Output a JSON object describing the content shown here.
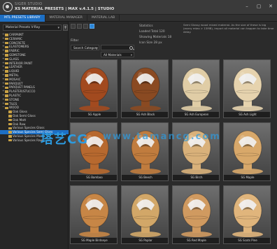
{
  "window": {
    "brand": "SIGER STUDIO",
    "title": "XS MATERIAL PRESETS | MAX v.4.1.5 | STUDIO",
    "icons": [
      "minimize-icon",
      "maximize-icon",
      "close-icon"
    ],
    "minimize_glyph": "–",
    "maximize_glyph": "▢",
    "close_glyph": "✕"
  },
  "tabs": [
    {
      "label": "MTL PRESETS LIBRARY",
      "active": true
    },
    {
      "label": "MATERIAL MANAGER",
      "active": false
    },
    {
      "label": "MATERIAL LAB",
      "active": false
    }
  ],
  "sidebar": {
    "library_select": "Material Presets V-Ray",
    "add_label": "+",
    "items": [
      {
        "label": "CARPAINT",
        "level": 0
      },
      {
        "label": "CERAMIC",
        "level": 0
      },
      {
        "label": "CONCRETE",
        "level": 0
      },
      {
        "label": "ELASTOMERS",
        "level": 0
      },
      {
        "label": "FABRIC",
        "level": 0
      },
      {
        "label": "GEMSTONE",
        "level": 0
      },
      {
        "label": "GLASS",
        "level": 0
      },
      {
        "label": "INTERIOR PAINT",
        "level": 0
      },
      {
        "label": "LEATHER",
        "level": 0
      },
      {
        "label": "LIQUID",
        "level": 0
      },
      {
        "label": "METAL",
        "level": 0
      },
      {
        "label": "MOSAIC",
        "level": 0
      },
      {
        "label": "PARQUET",
        "level": 0
      },
      {
        "label": "PARQUET PANELS",
        "level": 0
      },
      {
        "label": "PLASTER/STUCCO",
        "level": 0
      },
      {
        "label": "PLASTIC",
        "level": 0
      },
      {
        "label": "STONE",
        "level": 0
      },
      {
        "label": "TILES",
        "level": 0
      },
      {
        "label": "WOOD",
        "level": 0
      },
      {
        "label": "Oak Gloss",
        "level": 1
      },
      {
        "label": "Oak Semi Gloss",
        "level": 1
      },
      {
        "label": "Oak Matt",
        "level": 1
      },
      {
        "label": "Oak Raw",
        "level": 1
      },
      {
        "label": "Various Species Gloss",
        "level": 1
      },
      {
        "label": "Various Species Semi Gloss",
        "level": 1,
        "selected": true
      },
      {
        "label": "Various Species Matt",
        "level": 1
      },
      {
        "label": "Various Species Raw",
        "level": 1
      }
    ]
  },
  "filters": {
    "filter_label": "Filter",
    "category": "Search Category",
    "search_value": "",
    "sort": "All Materials"
  },
  "stats": {
    "title": "Statistics",
    "loaded": "Loaded Total 120",
    "showing": "Showing Materials 18",
    "icon_size": "Icon Size  28 px"
  },
  "description": "Semi Glossy wood mixed material. As the size of these is big (every mtex > 15MB), import all material can happen to take time delay.",
  "materials": [
    {
      "label": "SG Apple",
      "tone": "#a24a1f"
    },
    {
      "label": "SG Ash Black",
      "tone": "#8a4a22"
    },
    {
      "label": "SG Ash European",
      "tone": "#e0cda6"
    },
    {
      "label": "SG Ash Light",
      "tone": "#e6d3ae"
    },
    {
      "label": "SG Bamboo",
      "tone": "#b7692f"
    },
    {
      "label": "SG Beech",
      "tone": "#c07c3e"
    },
    {
      "label": "SG Birch",
      "tone": "#d9b17a"
    },
    {
      "label": "SG Maple",
      "tone": "#d8a86a"
    },
    {
      "label": "SG Maple Birdseye",
      "tone": "#c78646"
    },
    {
      "label": "SG Poplar",
      "tone": "#d2a768"
    },
    {
      "label": "SG Red Maple",
      "tone": "#d09a60"
    },
    {
      "label": "SG Scots Pine",
      "tone": "#e0b57c"
    }
  ],
  "watermark": {
    "cn": "塔艺CG",
    "url": "www.tamancg.com"
  }
}
